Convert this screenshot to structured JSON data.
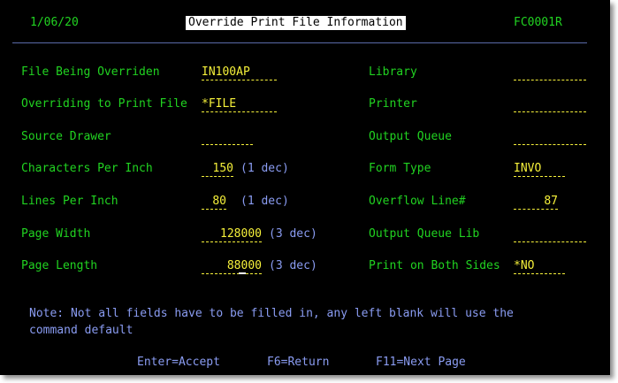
{
  "header": {
    "date": "1/06/20",
    "title": "Override Print File Information",
    "program": "FC0001R"
  },
  "left": {
    "file_label": "File Being Overriden",
    "file_value": "IN100AP",
    "printfile_label": "Overriding to Print File",
    "printfile_value": "*FILE",
    "drawer_label": "Source Drawer",
    "drawer_value": "",
    "cpi_label": "Characters Per Inch",
    "cpi_value": "150",
    "cpi_hint": "(1 dec)",
    "lpi_label": "Lines Per Inch",
    "lpi_value": "80",
    "lpi_hint": "(1 dec)",
    "width_label": "Page Width",
    "width_value": "128000",
    "width_hint": "(3 dec)",
    "length_label": "Page Length",
    "length_value": "88000",
    "length_hint": "(3 dec)"
  },
  "right": {
    "library_label": "Library",
    "library_value": "",
    "printer_label": "Printer",
    "printer_value": "",
    "outq_label": "Output Queue",
    "outq_value": "",
    "formtype_label": "Form Type",
    "formtype_value": "INVO",
    "overflow_label": "Overflow Line#",
    "overflow_value": "87",
    "outqlib_label": "Output Queue Lib",
    "outqlib_value": "",
    "bothsides_label": "Print on Both Sides",
    "bothsides_value": "*NO"
  },
  "note": {
    "line1": "Note: Not all fields have to be filled in, any left blank will use the",
    "line2": "command default"
  },
  "footer": {
    "enter": "Enter=Accept",
    "f6": "F6=Return",
    "f11": "F11=Next Page"
  },
  "colors": {
    "background": "#000000",
    "label": "#21d321",
    "hint": "#8a9cf2",
    "input": "#f5f03a"
  }
}
